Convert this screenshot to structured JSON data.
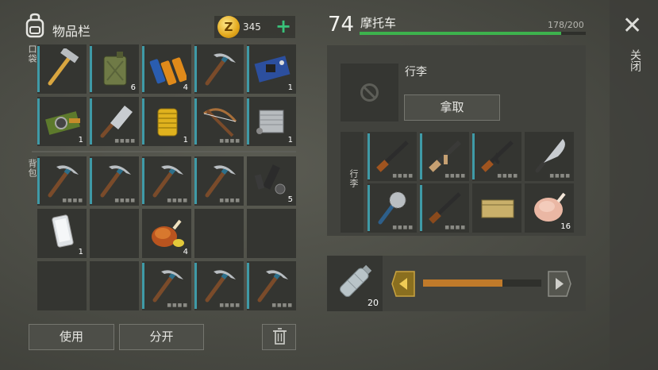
{
  "inventory": {
    "title": "物品栏",
    "coins": "345",
    "coin_symbol": "Z",
    "pockets_label": "口袋",
    "backpack_label": "背包",
    "pockets": [
      {
        "icon": "hammer-icon",
        "qty": ""
      },
      {
        "icon": "jerrycan-icon",
        "qty": "6"
      },
      {
        "icon": "batteries-icon",
        "qty": "4"
      },
      {
        "icon": "pickaxe-icon",
        "qty": ""
      },
      {
        "icon": "circuit-board-icon",
        "qty": "1"
      },
      {
        "icon": "camera-module-icon",
        "qty": "1"
      },
      {
        "icon": "cleaver-icon",
        "qty": ""
      },
      {
        "icon": "oil-filter-icon",
        "qty": "1"
      },
      {
        "icon": "crossbow-icon",
        "qty": ""
      },
      {
        "icon": "engine-block-icon",
        "qty": "1"
      }
    ],
    "backpack": [
      {
        "icon": "pickaxe-icon",
        "qty": ""
      },
      {
        "icon": "pickaxe-icon",
        "qty": ""
      },
      {
        "icon": "pickaxe-icon",
        "qty": ""
      },
      {
        "icon": "pickaxe-icon",
        "qty": ""
      },
      {
        "icon": "weapon-parts-icon",
        "qty": "5"
      },
      {
        "icon": "smartphone-icon",
        "qty": "1"
      },
      {
        "icon": "empty",
        "qty": ""
      },
      {
        "icon": "roast-chicken-icon",
        "qty": "4"
      },
      {
        "icon": "empty",
        "qty": ""
      },
      {
        "icon": "empty",
        "qty": ""
      },
      {
        "icon": "empty",
        "qty": ""
      },
      {
        "icon": "empty",
        "qty": ""
      },
      {
        "icon": "pickaxe-icon",
        "qty": ""
      },
      {
        "icon": "pickaxe-icon",
        "qty": ""
      },
      {
        "icon": "pickaxe-icon",
        "qty": ""
      }
    ],
    "use_label": "使用",
    "split_label": "分开"
  },
  "vehicle": {
    "level": "74",
    "name": "摩托车",
    "capacity": "178/200",
    "capacity_fraction": 0.89,
    "luggage_title": "行李",
    "take_label": "拿取",
    "luggage_side_label": "行李",
    "luggage": [
      {
        "icon": "rifle-icon",
        "qty": ""
      },
      {
        "icon": "assault-rifle-icon",
        "qty": ""
      },
      {
        "icon": "ak-rifle-icon",
        "qty": ""
      },
      {
        "icon": "machete-icon",
        "qty": ""
      },
      {
        "icon": "saw-club-icon",
        "qty": ""
      },
      {
        "icon": "shotgun-icon",
        "qty": ""
      },
      {
        "icon": "ammo-crate-icon",
        "qty": ""
      },
      {
        "icon": "raw-chicken-icon",
        "qty": "16"
      }
    ]
  },
  "fuel": {
    "bottle_qty": "20",
    "level_fraction": 0.67
  },
  "close_label": "关闭",
  "colors": {
    "accent_teal": "#3f9aa7",
    "capacity_green": "#3db24d",
    "fuel_orange": "#c07a2a",
    "coin_gold": "#e3a81c",
    "plus_green": "#39c27a"
  }
}
